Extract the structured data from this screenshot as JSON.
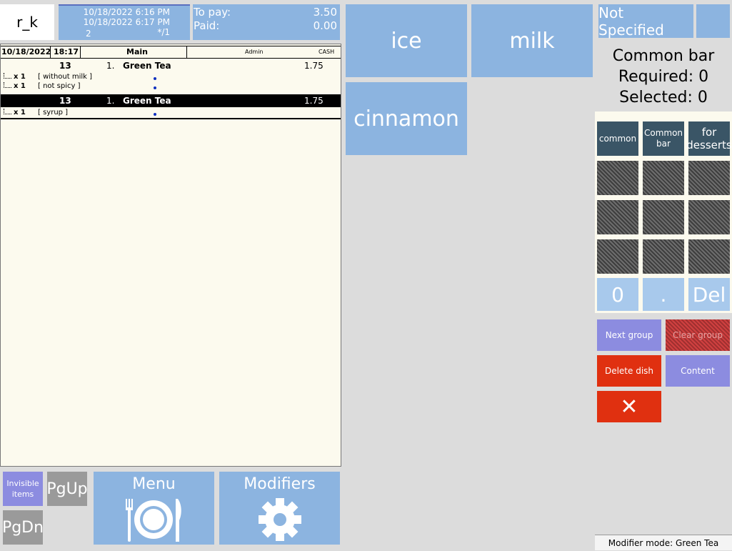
{
  "logo": {
    "text": "r_k"
  },
  "info": {
    "date_open": "10/18/2022 6:16 PM",
    "date_print": "10/18/2022 6:17 PM",
    "guests": "2",
    "table_ref": "*/1"
  },
  "payment": {
    "to_pay_label": "To pay:",
    "to_pay_value": "3.50",
    "paid_label": "Paid:",
    "paid_value": "0.00"
  },
  "order_header": {
    "date": "10/18/2022",
    "time": "18:17",
    "hall": "Main",
    "waiter": "Admin",
    "pay_type": "CASH"
  },
  "order": {
    "item1": {
      "seat": "13",
      "index": "1.",
      "name": "Green Tea",
      "price": "1.75",
      "mods": [
        {
          "qty": "x 1",
          "name": "[ without milk ]"
        },
        {
          "qty": "x 1",
          "name": "[ not spicy ]"
        }
      ]
    },
    "item2": {
      "seat": "13",
      "index": "1.",
      "name": "Green Tea",
      "price": "1.75",
      "mods": [
        {
          "qty": "x 1",
          "name": "[ syrup ]"
        }
      ]
    }
  },
  "bottom_nav": {
    "invisible": "Invisible items",
    "pgup": "PgUp",
    "pgdn": "PgDn",
    "menu": "Menu",
    "modifiers": "Modifiers"
  },
  "modifiers": {
    "ice": "ice",
    "milk": "milk",
    "cinnamon": "cinnamon"
  },
  "right_panel": {
    "not_specified": "Not Specified",
    "group_name": "Common bar",
    "required": "Required: 0",
    "selected": "Selected: 0",
    "groups": {
      "common": "common",
      "common_bar": "Common bar",
      "for_desserts": "for desserts"
    },
    "keypad": {
      "zero": "0",
      "dot": ".",
      "del": "Del"
    },
    "actions": {
      "next_group": "Next group",
      "clear_group": "Clear group",
      "delete_dish": "Delete dish",
      "content": "Content",
      "close": "✕"
    },
    "status": "Modifier mode: Green Tea"
  },
  "colors": {
    "accent_blue": "#8cb4e0",
    "dark_group": "#3a5566",
    "danger": "#e03010",
    "purple": "#8c8ce0"
  }
}
